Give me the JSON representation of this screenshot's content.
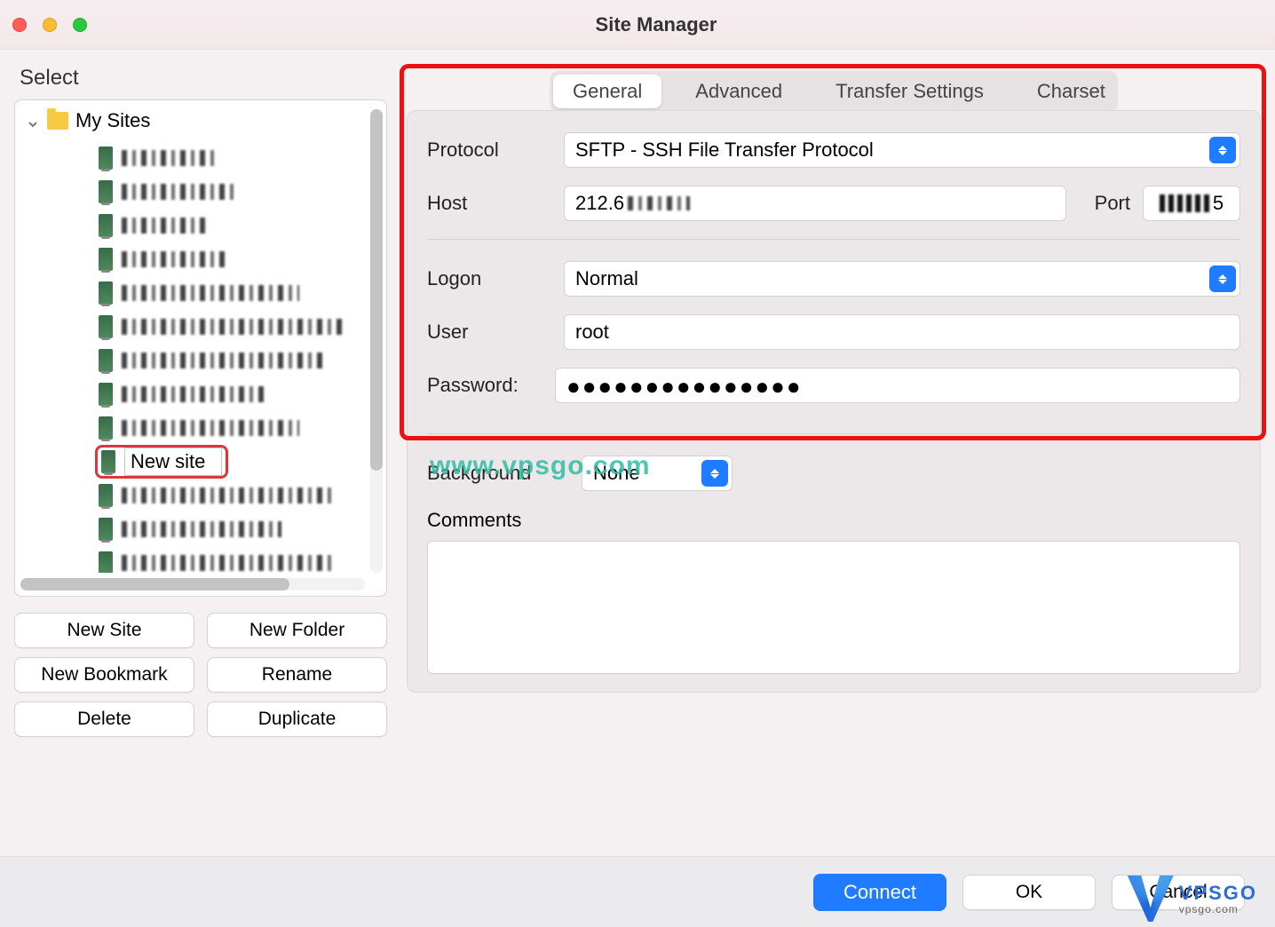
{
  "window": {
    "title": "Site Manager"
  },
  "left": {
    "label": "Select",
    "root": "My Sites",
    "new_site_editing": "New site",
    "buttons": {
      "new_site": "New Site",
      "new_folder": "New Folder",
      "new_bookmark": "New Bookmark",
      "rename": "Rename",
      "delete": "Delete",
      "duplicate": "Duplicate"
    }
  },
  "tabs": {
    "general": "General",
    "advanced": "Advanced",
    "transfer": "Transfer Settings",
    "charset": "Charset"
  },
  "form": {
    "protocol_label": "Protocol",
    "protocol_value": "SFTP - SSH File Transfer Protocol",
    "host_label": "Host",
    "host_value": "212.6",
    "port_label": "Port",
    "port_value_suffix": "5",
    "logon_label": "Logon",
    "logon_value": "Normal",
    "user_label": "User",
    "user_value": "root",
    "password_label": "Password:",
    "password_masked": "●●●●●●●●●●●●●●●",
    "background_label": "Background",
    "background_value": "None",
    "comments_label": "Comments"
  },
  "footer": {
    "connect": "Connect",
    "ok": "OK",
    "cancel": "Cancel"
  },
  "watermark": "www.vpsgo.com",
  "logo": {
    "big": "VPSGO",
    "small": "vpsgo.com"
  }
}
